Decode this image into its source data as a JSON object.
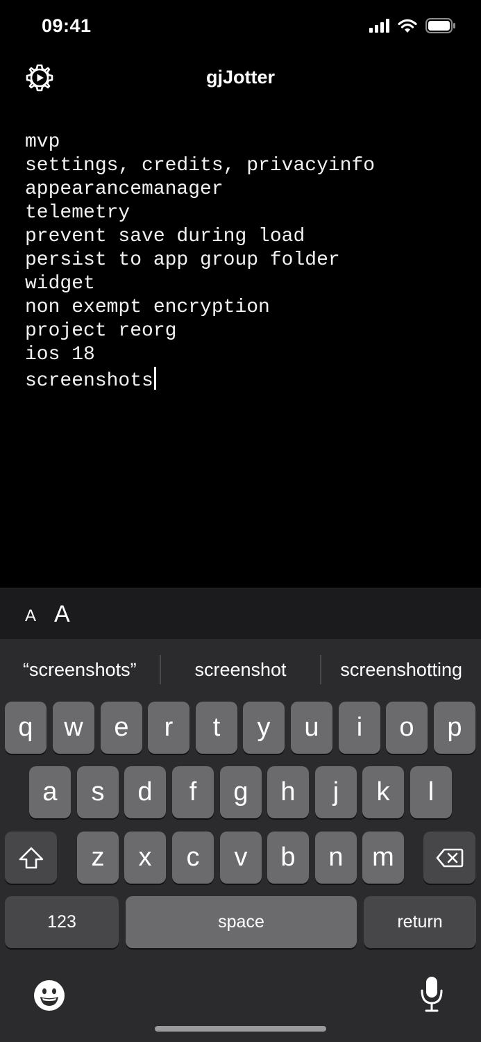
{
  "status_bar": {
    "time": "09:41"
  },
  "header": {
    "title": "gjJotter"
  },
  "note": {
    "lines": [
      "mvp",
      "settings, credits, privacyinfo",
      "appearancemanager",
      "telemetry",
      "prevent save during load",
      "persist to app group folder",
      "widget",
      "non exempt encryption",
      "project reorg",
      "ios 18",
      "screenshots"
    ]
  },
  "accessory": {
    "font_smaller_label": "A",
    "font_larger_label": "A"
  },
  "keyboard": {
    "suggestions": [
      "“screenshots”",
      "screenshot",
      "screenshotting"
    ],
    "row1": [
      "q",
      "w",
      "e",
      "r",
      "t",
      "y",
      "u",
      "i",
      "o",
      "p"
    ],
    "row2": [
      "a",
      "s",
      "d",
      "f",
      "g",
      "h",
      "j",
      "k",
      "l"
    ],
    "row3": [
      "z",
      "x",
      "c",
      "v",
      "b",
      "n",
      "m"
    ],
    "numbers_label": "123",
    "space_label": "space",
    "return_label": "return"
  },
  "icons": {
    "settings": "gear-icon",
    "shift": "shift-icon",
    "delete": "delete-icon",
    "emoji": "emoji-icon",
    "dictation": "microphone-icon",
    "signal": "cellular-signal-icon",
    "wifi": "wifi-icon",
    "battery": "battery-icon"
  }
}
